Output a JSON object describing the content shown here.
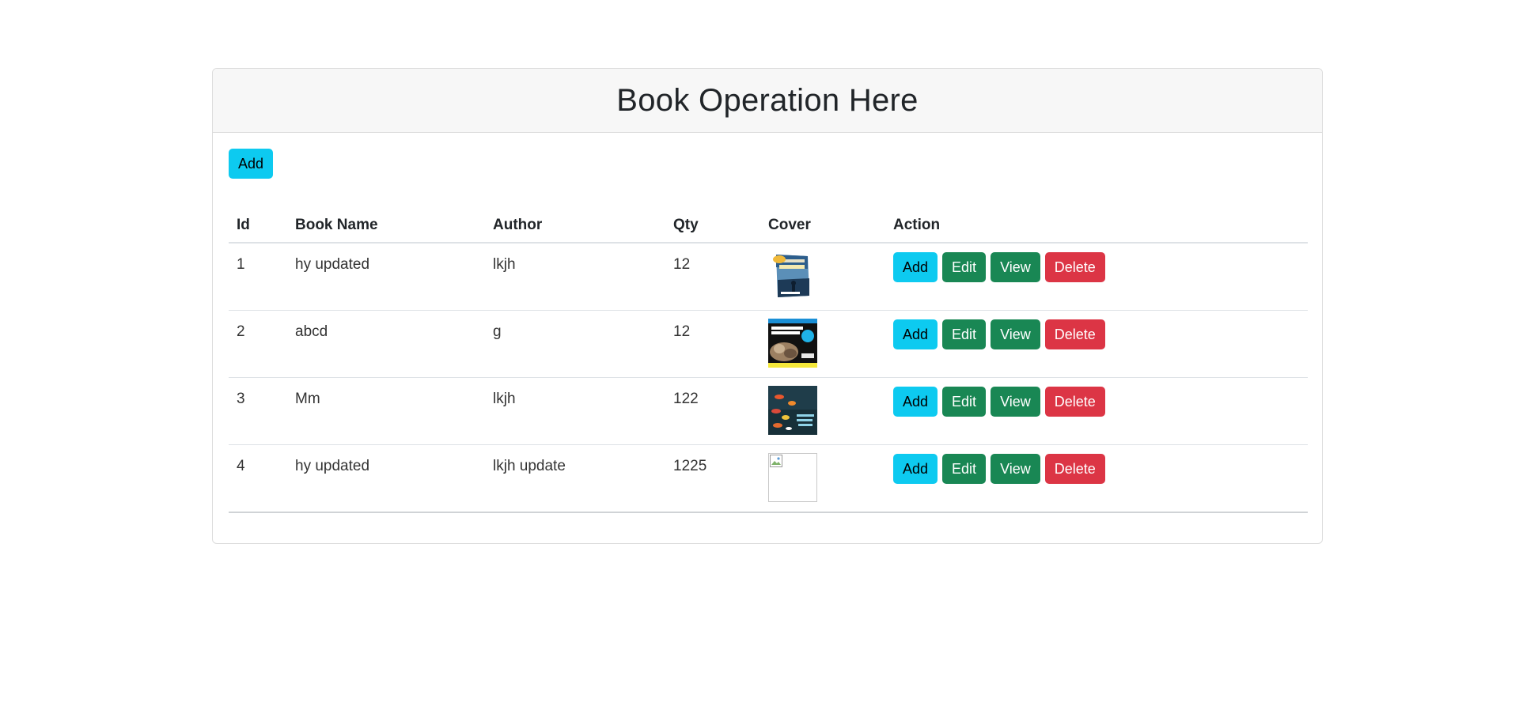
{
  "page": {
    "title": "Book Operation Here",
    "add_button_label": "Add"
  },
  "table": {
    "headers": {
      "id": "Id",
      "name": "Book Name",
      "author": "Author",
      "qty": "Qty",
      "cover": "Cover",
      "action": "Action"
    },
    "rows": [
      {
        "id": "1",
        "name": "hy updated",
        "author": "lkjh",
        "qty": "12",
        "cover": "miracle-morning-cover"
      },
      {
        "id": "2",
        "name": "abcd",
        "author": "g",
        "qty": "12",
        "cover": "american-revolution-cover"
      },
      {
        "id": "3",
        "name": "Mm",
        "author": "lkjh",
        "qty": "122",
        "cover": "colorful-fish-cover"
      },
      {
        "id": "4",
        "name": "hy updated",
        "author": "lkjh update",
        "qty": "1225",
        "cover": "broken-image"
      }
    ],
    "actions": {
      "add": "Add",
      "edit": "Edit",
      "view": "View",
      "delete": "Delete"
    }
  },
  "colors": {
    "info": "#0dcaf0",
    "success": "#198754",
    "danger": "#dc3545",
    "header_bg": "#f7f7f7"
  }
}
